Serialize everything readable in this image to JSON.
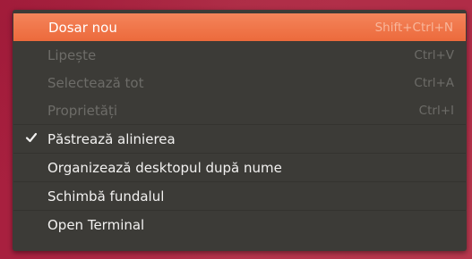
{
  "menu": {
    "items": [
      {
        "label": "Dosar nou",
        "shortcut": "Shift+Ctrl+N",
        "state": "highlighted",
        "checked": false
      },
      {
        "label": "Lipește",
        "shortcut": "Ctrl+V",
        "state": "disabled",
        "checked": false
      },
      {
        "label": "Selectează tot",
        "shortcut": "Ctrl+A",
        "state": "disabled",
        "checked": false
      },
      {
        "label": "Proprietăți",
        "shortcut": "Ctrl+I",
        "state": "disabled",
        "checked": false
      },
      {
        "label": "Păstrează alinierea",
        "shortcut": "",
        "state": "normal",
        "checked": true
      },
      {
        "label": "Organizează desktopul după nume",
        "shortcut": "",
        "state": "normal",
        "checked": false
      },
      {
        "label": "Schimbă fundalul",
        "shortcut": "",
        "state": "normal",
        "checked": false
      },
      {
        "label": "Open Terminal",
        "shortcut": "",
        "state": "normal",
        "checked": false
      }
    ]
  },
  "colors": {
    "menu_background": "#3c3b37",
    "highlight": "#ec6a3c",
    "desktop": "#b02c47"
  },
  "icons": {
    "check": "check-icon"
  }
}
